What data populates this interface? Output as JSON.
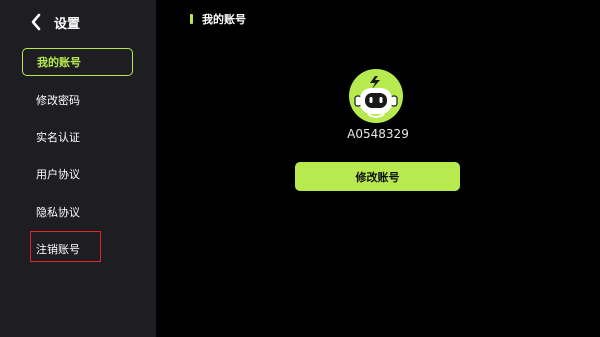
{
  "header": {
    "back_icon": "chevron-left-icon",
    "title": "设置"
  },
  "sidebar": {
    "items": [
      {
        "label": "我的账号",
        "active": true
      },
      {
        "label": "修改密码",
        "active": false
      },
      {
        "label": "实名认证",
        "active": false
      },
      {
        "label": "用户协议",
        "active": false
      },
      {
        "label": "隐私协议",
        "active": false
      },
      {
        "label": "注销账号",
        "active": false,
        "highlighted": true
      }
    ]
  },
  "main": {
    "title": "我的账号",
    "avatar_icon": "robot-avatar-icon",
    "account_id": "A0548329",
    "edit_button_label": "修改账号"
  },
  "colors": {
    "accent": "#b7ea4f",
    "sidebar_bg": "#1d1d22",
    "background": "#000000",
    "annotation": "#e0262a"
  }
}
